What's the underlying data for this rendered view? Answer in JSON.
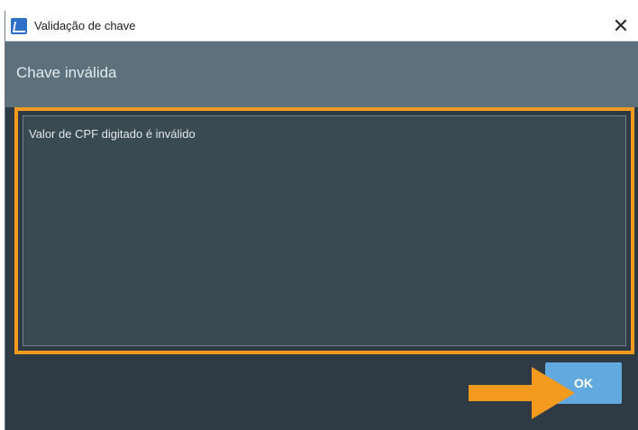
{
  "window": {
    "title": "Validação de chave",
    "close_glyph": "✕",
    "icon": "app-icon"
  },
  "header": {
    "title": "Chave inválida"
  },
  "message": {
    "text": "Valor de CPF digitado é inválido"
  },
  "footer": {
    "ok_label": "OK"
  },
  "annotations": {
    "highlight_color": "#f39a1f",
    "arrow": "arrow-right-icon"
  }
}
